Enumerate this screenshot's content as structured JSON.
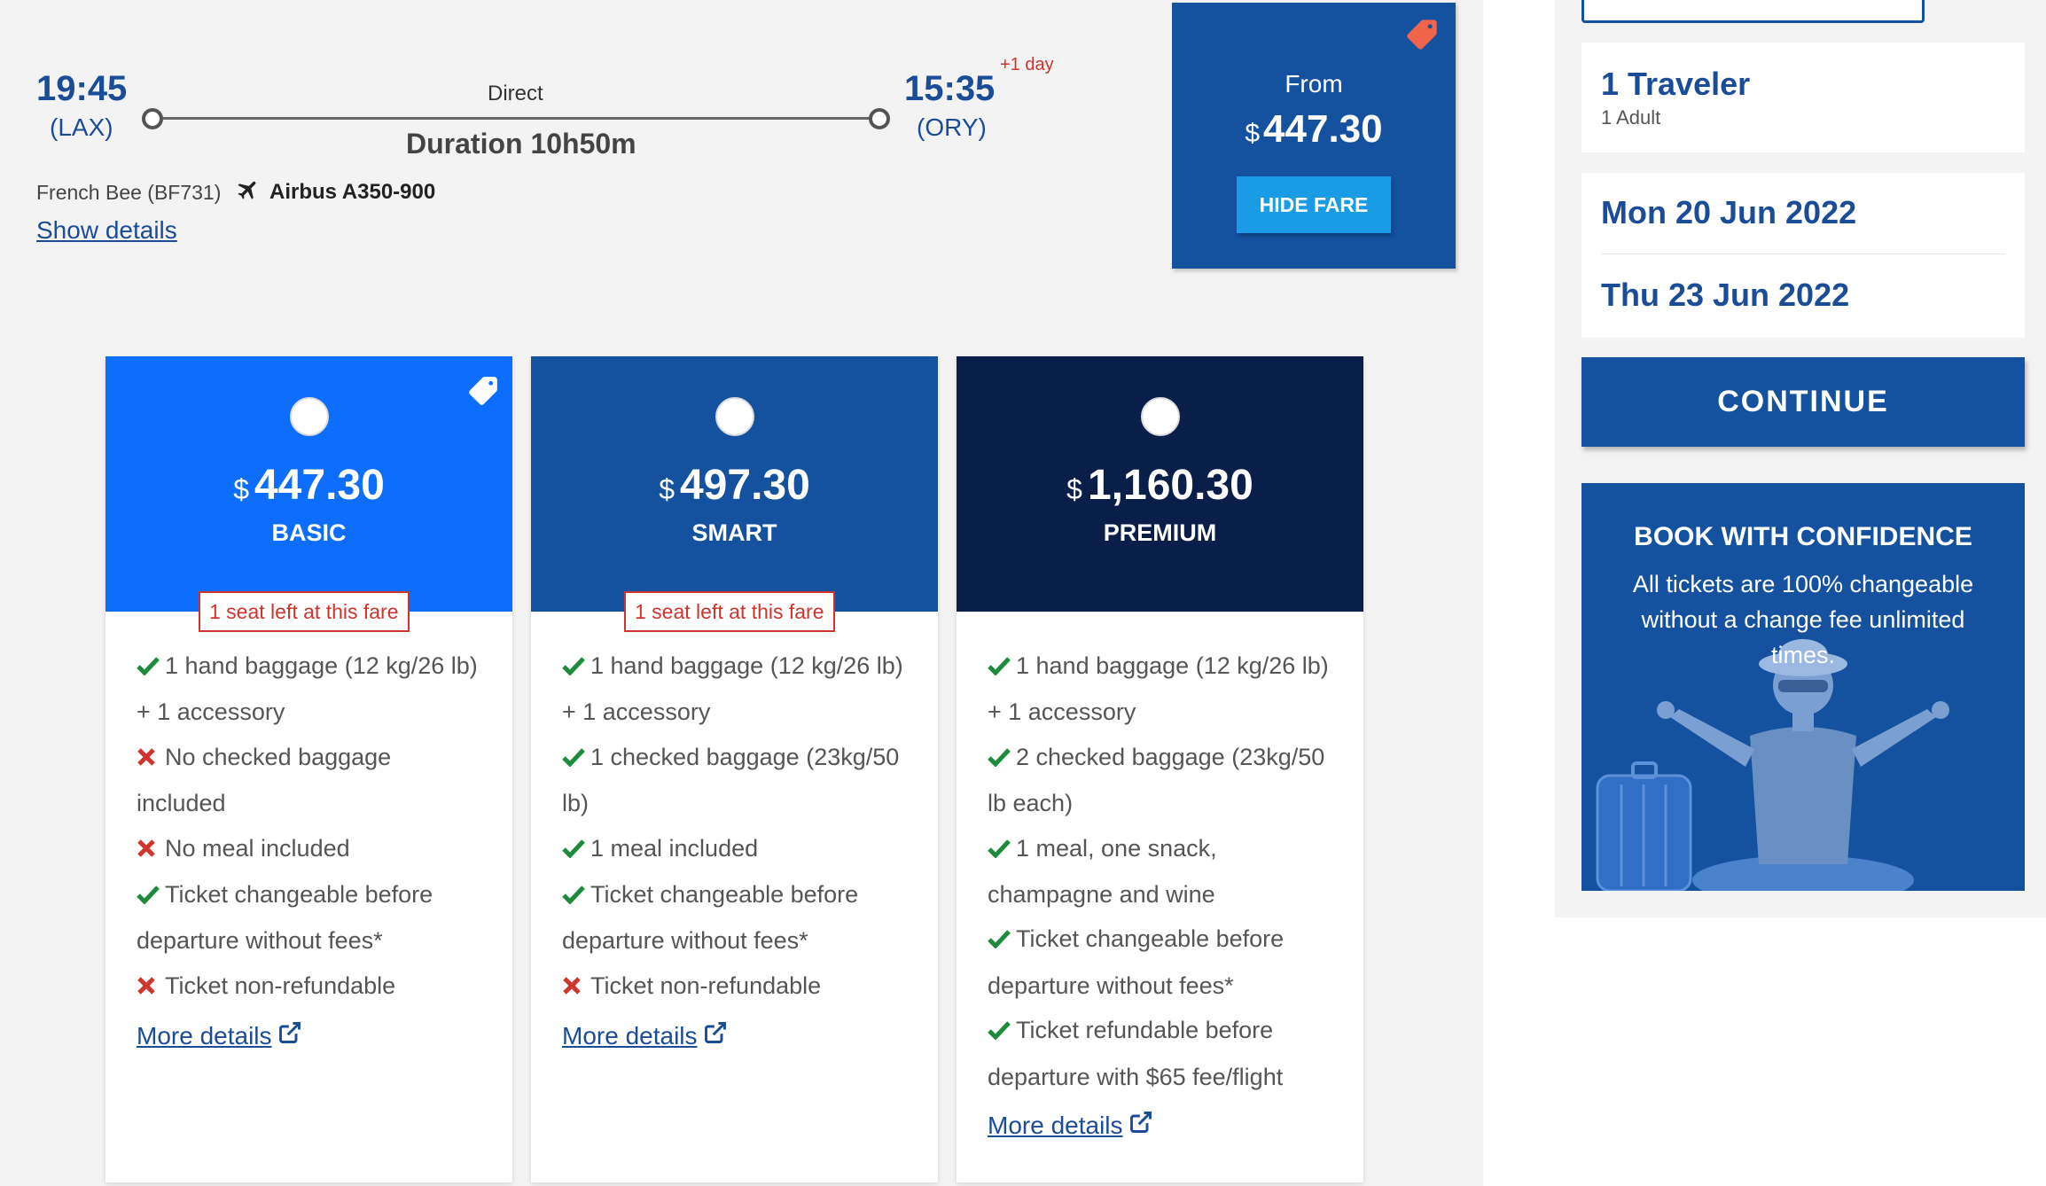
{
  "flight": {
    "departure_time": "19:45",
    "departure_code": "(LAX)",
    "arrival_time": "15:35",
    "arrival_code": "(ORY)",
    "plus_day": "+1 day",
    "stops": "Direct",
    "duration": "Duration 10h50m",
    "carrier": "French Bee (BF731)",
    "aircraft": "Airbus A350-900",
    "show_details": "Show details"
  },
  "from_box": {
    "label": "From",
    "currency": "$",
    "price": "447.30",
    "hide_fare": "HIDE FARE"
  },
  "fares": [
    {
      "currency": "$",
      "price": "447.30",
      "name": "BASIC",
      "badge": "1 seat left at this fare",
      "features": [
        {
          "ok": true,
          "text": "1 hand baggage (12 kg/26 lb) + 1 accessory"
        },
        {
          "ok": false,
          "text": "No checked baggage included"
        },
        {
          "ok": false,
          "text": "No meal included"
        },
        {
          "ok": true,
          "text": "Ticket changeable before departure without fees*"
        },
        {
          "ok": false,
          "text": "Ticket non-refundable"
        }
      ],
      "more": "More details"
    },
    {
      "currency": "$",
      "price": "497.30",
      "name": "SMART",
      "badge": "1 seat left at this fare",
      "features": [
        {
          "ok": true,
          "text": "1 hand baggage (12 kg/26 lb) + 1 accessory"
        },
        {
          "ok": true,
          "text": "1 checked baggage (23kg/50 lb)"
        },
        {
          "ok": true,
          "text": "1 meal included"
        },
        {
          "ok": true,
          "text": "Ticket changeable before departure without fees*"
        },
        {
          "ok": false,
          "text": "Ticket non-refundable"
        }
      ],
      "more": "More details"
    },
    {
      "currency": "$",
      "price": "1,160.30",
      "name": "PREMIUM",
      "features": [
        {
          "ok": true,
          "text": "1 hand baggage (12 kg/26 lb) + 1 accessory"
        },
        {
          "ok": true,
          "text": "2 checked baggage (23kg/50 lb each)"
        },
        {
          "ok": true,
          "text": "1 meal, one snack, champagne and wine"
        },
        {
          "ok": true,
          "text": "Ticket changeable before departure without fees*"
        },
        {
          "ok": true,
          "text": "Ticket refundable before departure with $65 fee/flight"
        }
      ],
      "more": "More details"
    }
  ],
  "sidebar": {
    "traveler_title": "1 Traveler",
    "traveler_sub": "1 Adult",
    "date_out": "Mon 20 Jun 2022",
    "date_return": "Thu 23 Jun 2022",
    "continue": "CONTINUE",
    "confidence_title": "BOOK WITH CONFIDENCE",
    "confidence_text": "All tickets are 100% changeable without a change fee unlimited times."
  },
  "colors": {
    "brand_blue": "#1452a0",
    "basic": "#0d6efd",
    "smart": "#1452a0",
    "premium": "#0a1e4a",
    "check": "#1e8a3c",
    "cross": "#d0342c",
    "badge": "#d0342c",
    "hide_fare": "#1a9be6"
  },
  "icons": {
    "plane": "airplane-icon",
    "tag": "price-tag-icon",
    "external": "external-link-icon",
    "check": "check-icon",
    "cross": "cross-icon"
  }
}
